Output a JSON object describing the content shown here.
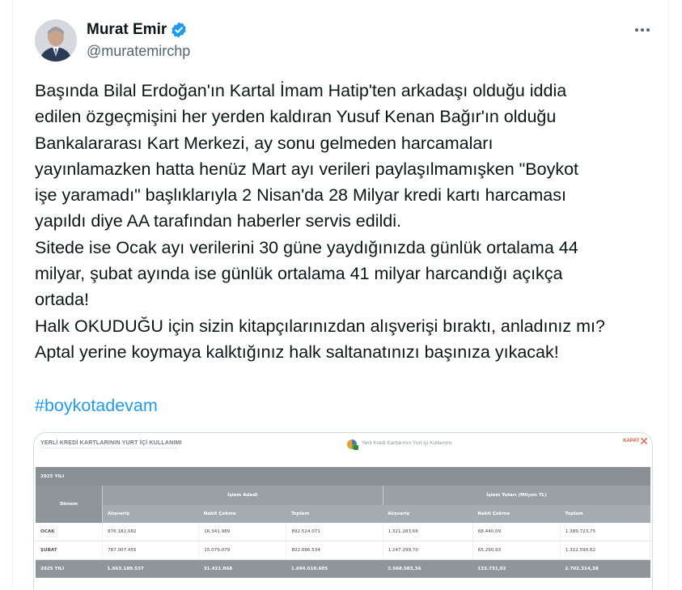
{
  "author": {
    "name": "Murat Emir",
    "handle": "@muratemirchp"
  },
  "tweet": {
    "text": "Başında Bilal Erdoğan'ın Kartal İmam Hatip'ten arkadaşı olduğu iddia\nedilen özgeçmişini her yerden kaldıran Yusuf Kenan Bağır'ın olduğu\nBankalararası Kart Merkezi, ay sonu gelmeden harcamaları\nyayınlamazken hatta henüz Mart ayı verileri paylaşılmamışken \"Boykot\nişe yaramadı\" başlıklarıyla 2 Nisan'da 28 Milyar kredi kartı harcaması\nyapıldı diye AA tarafından haberler servis edildi.\nSitede ise Ocak ayı verilerini 30 güne yaydığınızda günlük ortalama 44\nmilyar, şubat ayında ise günlük ortalama 41 milyar harcandığı açıkça\nortada!\nHalk OKUDUĞU için sizin kitapçılarınızdan alışverişi bıraktı, anladınız mı?\nAptal yerine koymaya kalktığınız halk saltanatınızı başınıza yıkacak!",
    "hashtag": "#boykotadevam"
  },
  "media": {
    "title": "YERLİ KREDİ KARTLARININ YURT İÇİ KULLANIMI",
    "subtitle": "Yerli Kredi Kartlarının Yurt içi Kullanımı",
    "close_label": "KAPAT",
    "close_icon": "✕",
    "table": {
      "year": "2025 YILI",
      "period_header": "Dönem",
      "group1": "İşlem Adedi",
      "group2": "İşlem Tutarı (Milyon TL)",
      "columns": [
        "Alışveriş",
        "Nakit Çekme",
        "Toplam",
        "Alışveriş",
        "Nakit Çekme",
        "Toplam"
      ],
      "rows": [
        {
          "period": "OCAK",
          "values": [
            "876.182.082",
            "16.341.989",
            "892.524.071",
            "1.321.283,66",
            "68.440,09",
            "1.389.723,75"
          ]
        },
        {
          "period": "ŞUBAT",
          "values": [
            "787.007.455",
            "15.079.079",
            "802.086.534",
            "1.247.299,70",
            "65.290,93",
            "1.312.590,62"
          ]
        }
      ],
      "total": {
        "period": "2025 YILI",
        "values": [
          "1.663.189.537",
          "31.421.068",
          "1.694.610.605",
          "2.568.583,36",
          "133.731,02",
          "2.702.314,38"
        ]
      }
    }
  },
  "colors": {
    "link": "#1d9bf0",
    "verified": "#1d9bf0",
    "close": "#e05a3b"
  }
}
